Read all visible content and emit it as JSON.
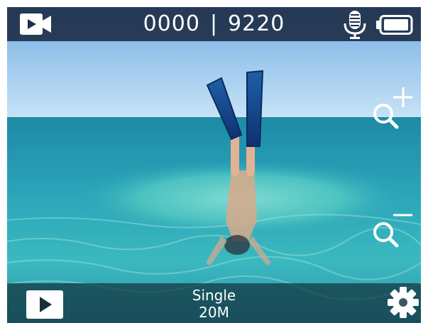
{
  "status_bar": {
    "mode_icon": "video-camera-icon",
    "photos_taken": "0000",
    "separator": "|",
    "photos_remaining": "9220",
    "mic_icon": "microphone-icon",
    "battery_icon": "battery-icon"
  },
  "zoom": {
    "zoom_in_icon": "zoom-in-icon",
    "zoom_out_icon": "zoom-out-icon"
  },
  "bottom_bar": {
    "playback_icon": "play-icon",
    "shot_mode": "Single",
    "resolution": "20M",
    "settings_icon": "gear-icon"
  },
  "colors": {
    "bar_dark": "#1e304a",
    "icon": "#ffffff",
    "sky": "#9fcbee",
    "water": "#2f9fb6"
  }
}
